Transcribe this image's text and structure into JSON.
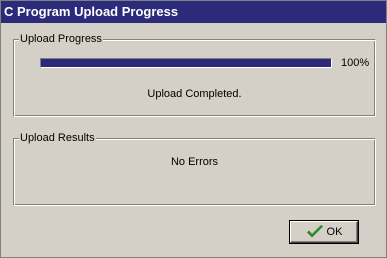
{
  "window": {
    "title": "C Program Upload Progress"
  },
  "upload_progress": {
    "group_label": "Upload Progress",
    "percent_text": "100%",
    "progress_fraction": 1.0,
    "status": "Upload Completed."
  },
  "upload_results": {
    "group_label": "Upload Results",
    "message": "No Errors"
  },
  "ok_button": {
    "label": "OK",
    "icon": "checkmark-icon"
  },
  "colors": {
    "titlebar": "#2c2a7a",
    "progress_fill": "#2e2878",
    "window_face": "#d4d0c8",
    "check_green": "#2f9a2f"
  }
}
